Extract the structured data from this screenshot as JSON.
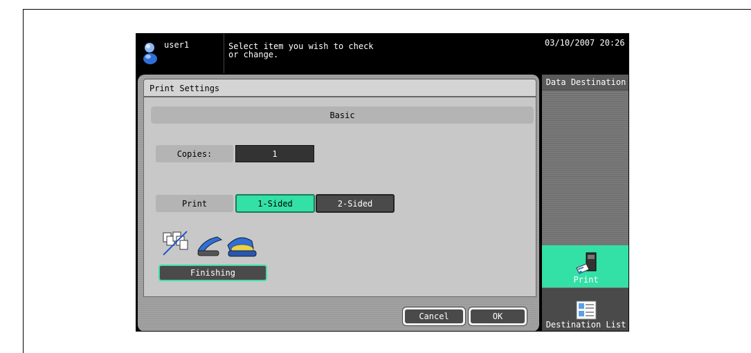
{
  "header": {
    "user": "user1",
    "message_line1": "Select item you wish to check",
    "message_line2": "or change.",
    "datetime": "03/10/2007 20:26"
  },
  "panel": {
    "title": "Print Settings",
    "section": "Basic",
    "copies_label": "Copies:",
    "copies_value": "1",
    "print_label": "Print",
    "one_sided": "1-Sided",
    "two_sided": "2-Sided",
    "finishing": "Finishing"
  },
  "footer": {
    "cancel": "Cancel",
    "ok": "OK"
  },
  "right_panel": {
    "title": "Data Destination",
    "print": "Print",
    "destination_list": "Destination List"
  },
  "colors": {
    "accent_green": "#33e0a6",
    "dark_button": "#4a4a4a"
  },
  "icons": [
    "user-icon",
    "finishing-icon",
    "printer-icon",
    "destination-list-icon"
  ]
}
